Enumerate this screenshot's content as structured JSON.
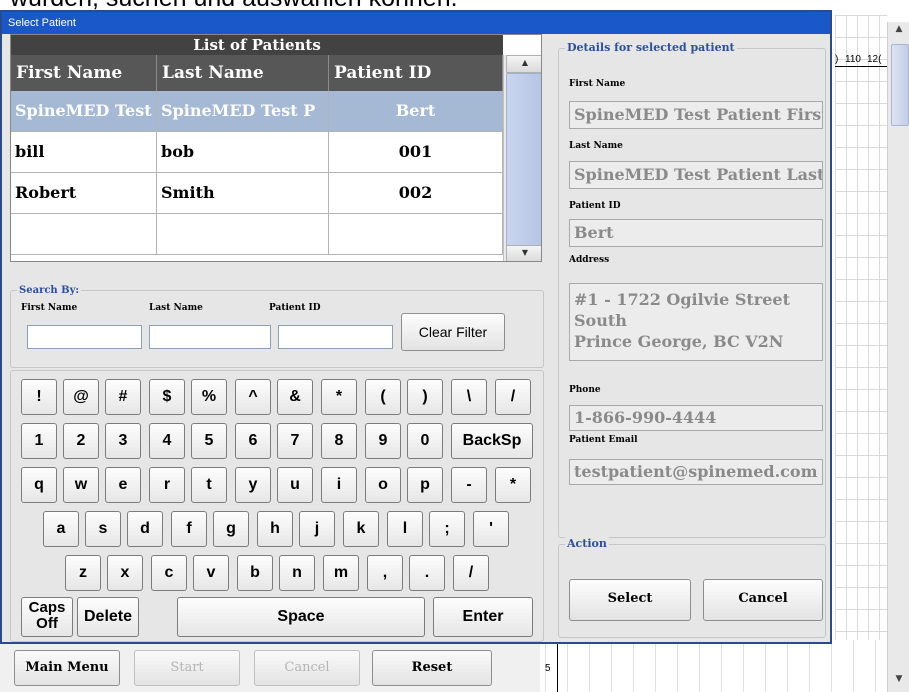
{
  "background": {
    "heading_fragment": "wurden, suchen und auswählen können.",
    "ruler_ticks": [
      "110",
      "12("
    ],
    "axis_tick": "5",
    "bottom_buttons": [
      {
        "label": "Main Menu",
        "enabled": true
      },
      {
        "label": "Start",
        "enabled": false
      },
      {
        "label": "Cancel",
        "enabled": false
      },
      {
        "label": "Reset",
        "enabled": true
      }
    ]
  },
  "dialog": {
    "title": "Select Patient",
    "accent_color": "#1a57c9",
    "table": {
      "caption": "List of Patients",
      "columns": [
        "First Name",
        "Last Name",
        "Patient ID"
      ],
      "rows": [
        {
          "first": "SpineMED Test",
          "last": "SpineMED Test P",
          "id": "Bert",
          "selected": true
        },
        {
          "first": "bill",
          "last": "bob",
          "id": "001",
          "selected": false
        },
        {
          "first": "Robert",
          "last": "Smith",
          "id": "002",
          "selected": false
        },
        {
          "first": "",
          "last": "",
          "id": "",
          "selected": false
        }
      ]
    },
    "search": {
      "legend": "Search By:",
      "first_name_label": "First Name",
      "last_name_label": "Last Name",
      "patient_id_label": "Patient ID",
      "first_name_value": "",
      "last_name_value": "",
      "patient_id_value": "",
      "clear_filter_label": "Clear Filter"
    },
    "keyboard": {
      "row1": [
        "!",
        "@",
        "#",
        "$",
        "%",
        "^",
        "&",
        "*",
        "(",
        ")",
        "\\",
        "/"
      ],
      "row2": [
        "1",
        "2",
        "3",
        "4",
        "5",
        "6",
        "7",
        "8",
        "9",
        "0",
        "BackSp"
      ],
      "row3": [
        "q",
        "w",
        "e",
        "r",
        "t",
        "y",
        "u",
        "i",
        "o",
        "p",
        "-",
        "*"
      ],
      "row4": [
        "a",
        "s",
        "d",
        "f",
        "g",
        "h",
        "j",
        "k",
        "l",
        ";",
        "'"
      ],
      "row5": [
        "z",
        "x",
        "c",
        "v",
        "b",
        "n",
        "m",
        ",",
        ".",
        "/"
      ],
      "caps_label": "Caps\nOff",
      "delete_label": "Delete",
      "space_label": "Space",
      "enter_label": "Enter"
    },
    "details": {
      "legend": "Details for selected patient",
      "first_name_label": "First Name",
      "first_name_value": "SpineMED Test Patient First",
      "last_name_label": "Last Name",
      "last_name_value": "SpineMED Test Patient Last",
      "patient_id_label": "Patient ID",
      "patient_id_value": "Bert",
      "address_label": "Address",
      "address_value": "#1 - 1722 Ogilvie Street\nSouth\nPrince George, BC  V2N",
      "phone_label": "Phone",
      "phone_value": "1-866-990-4444",
      "email_label": "Patient Email",
      "email_value": "testpatient@spinemed.com"
    },
    "action": {
      "legend": "Action",
      "select_label": "Select",
      "cancel_label": "Cancel"
    }
  }
}
